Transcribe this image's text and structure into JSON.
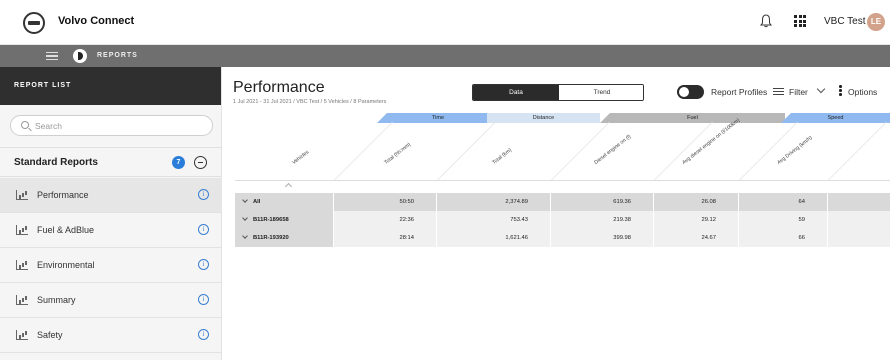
{
  "app": {
    "title": "Volvo Connect",
    "user_name": "VBC Test",
    "user_initials": "LE"
  },
  "nav": {
    "section": "REPORTS"
  },
  "sidebar": {
    "header": "REPORT LIST",
    "search_placeholder": "Search",
    "group_title": "Standard Reports",
    "group_count": "7",
    "items": [
      {
        "label": "Performance",
        "active": true
      },
      {
        "label": "Fuel & AdBlue"
      },
      {
        "label": "Environmental"
      },
      {
        "label": "Summary"
      },
      {
        "label": "Safety"
      }
    ]
  },
  "report": {
    "title": "Performance",
    "subtitle": "1 Jul 2021 - 31 Jul 2021 / VBC Test / 5 Vehicles / 8 Parameters",
    "view_tabs": [
      "Data",
      "Trend"
    ],
    "report_profiles_label": "Report Profiles",
    "filter_label": "Filter",
    "options_label": "Options",
    "groups": [
      "Time",
      "Distance",
      "Fuel",
      "Speed"
    ],
    "columns": [
      "Vehicles",
      "Total (hh:mm)",
      "Total (km)",
      "Diesel engine on (l)",
      "Avg diesel engine on (l/100km)",
      "Avg Driving (km/h)"
    ],
    "rows": [
      {
        "name": "All",
        "values": [
          "50:50",
          "2,374.89",
          "619.36",
          "26.08",
          "64"
        ]
      },
      {
        "name": "B11R-189658",
        "values": [
          "22:36",
          "753.43",
          "219.38",
          "29.12",
          "59"
        ]
      },
      {
        "name": "B11R-193920",
        "values": [
          "28:14",
          "1,621.46",
          "399.98",
          "24.67",
          "66"
        ]
      }
    ]
  },
  "colors": {
    "accent_blue": "#2a7dd8",
    "band_blue": "#8fb9ef",
    "dark": "#2b2b2b",
    "nav_gray": "#6f6f6f"
  }
}
